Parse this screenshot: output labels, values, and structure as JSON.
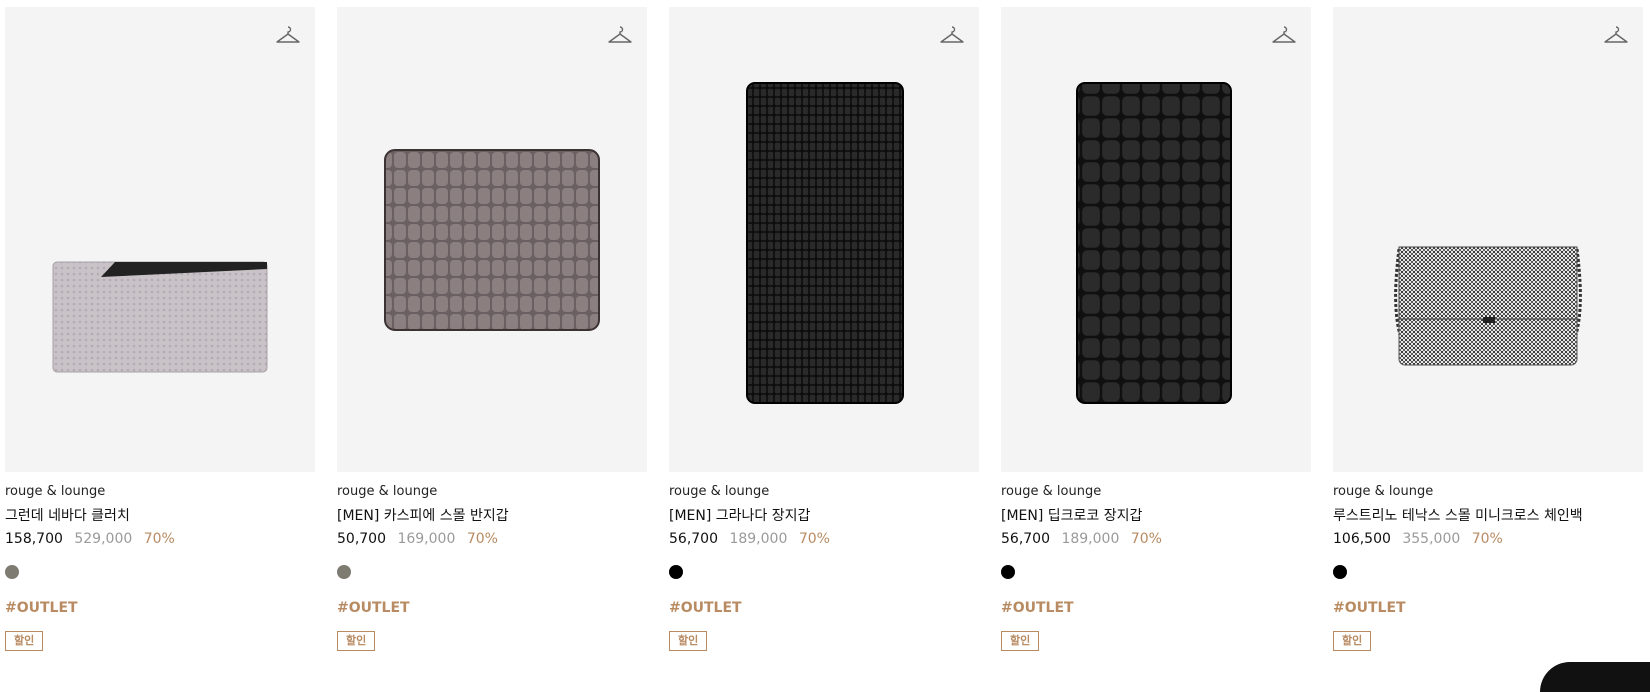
{
  "products": [
    {
      "brand": "rouge & lounge",
      "name": "그런데 네바다 클러치",
      "price": "158,700",
      "original_price": "529,000",
      "discount": "70%",
      "swatch_color": "#7d7b72",
      "tag": "#OUTLET",
      "badge": "할인",
      "image": "light-gray-clutch"
    },
    {
      "brand": "rouge & lounge",
      "name": "[MEN] 카스피에 스몰 반지갑",
      "price": "50,700",
      "original_price": "169,000",
      "discount": "70%",
      "swatch_color": "#7d7b72",
      "tag": "#OUTLET",
      "badge": "할인",
      "image": "gray-croc-bifold-wallet"
    },
    {
      "brand": "rouge & lounge",
      "name": "[MEN] 그라나다 장지갑",
      "price": "56,700",
      "original_price": "189,000",
      "discount": "70%",
      "swatch_color": "#000000",
      "tag": "#OUTLET",
      "badge": "할인",
      "image": "black-lizard-long-wallet"
    },
    {
      "brand": "rouge & lounge",
      "name": "[MEN] 딥크로코 장지갑",
      "price": "56,700",
      "original_price": "189,000",
      "discount": "70%",
      "swatch_color": "#000000",
      "tag": "#OUTLET",
      "badge": "할인",
      "image": "black-croc-long-wallet"
    },
    {
      "brand": "rouge & lounge",
      "name": "루스트리노 테낙스 스몰 미니크로스 체인백",
      "price": "106,500",
      "original_price": "355,000",
      "discount": "70%",
      "swatch_color": "#000000",
      "tag": "#OUTLET",
      "badge": "할인",
      "image": "houndstooth-chain-bag"
    }
  ],
  "icons": {
    "wishlist": "hanger-icon"
  },
  "colors": {
    "accent": "#b88b63",
    "muted": "#9a9a9a",
    "tile_bg": "#f4f4f4"
  }
}
